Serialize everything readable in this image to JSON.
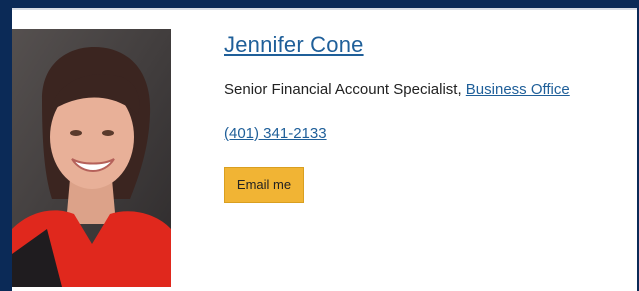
{
  "profile": {
    "name": "Jennifer Cone",
    "title": "Senior Financial Account Specialist, ",
    "department": "Business Office",
    "phone": "(401) 341-2133",
    "email_button": "Email me"
  },
  "colors": {
    "background": "#0b2a57",
    "link": "#1f5f99",
    "button": "#f1b434"
  },
  "icons": {
    "photo": "staff-portrait"
  }
}
